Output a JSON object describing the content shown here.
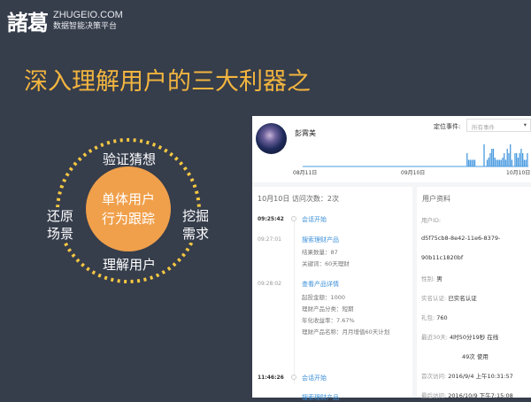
{
  "logo": {
    "cn": "諸葛",
    "en": "ZHUGEIO.COM",
    "sub": "数据智能决策平台"
  },
  "title": "深入理解用户的三大利器之",
  "diagram": {
    "center": [
      "单体用户",
      "行为跟踪"
    ],
    "top": "验证猜想",
    "left": [
      "还原",
      "场景"
    ],
    "right": [
      "挖掘",
      "需求"
    ],
    "bottom": "理解用户"
  },
  "colors": {
    "bg": "#363d4b",
    "accent": "#f3b53f",
    "orange": "#f0a04b",
    "dots": "#f5c842",
    "link": "#3b8fd9"
  },
  "panel": {
    "user_name": "彭霄美",
    "filter_label": "定位事件:",
    "filter_value": "所有事件",
    "chart_data": {
      "type": "bar",
      "x_labels": [
        "08月11日",
        "09月10日",
        "10月10日"
      ],
      "values": [
        0,
        0,
        0,
        0,
        0,
        0,
        0,
        0,
        0,
        0,
        0,
        0,
        0,
        0,
        0,
        0,
        0,
        0,
        0,
        0,
        0,
        0,
        0,
        0,
        0,
        0,
        0,
        0,
        0,
        0,
        0,
        0,
        0,
        0,
        0,
        0,
        0,
        0,
        0,
        0,
        0,
        0,
        0,
        0,
        0,
        0,
        0,
        0,
        0,
        0,
        0,
        0,
        0,
        0,
        0,
        0,
        0,
        0,
        0,
        0,
        0,
        0,
        0,
        0,
        0,
        0,
        0,
        0,
        0,
        0,
        0,
        0,
        0,
        0,
        0,
        0,
        0,
        0,
        0,
        0,
        0,
        0,
        0,
        0,
        0,
        0,
        0,
        0,
        0,
        0,
        0,
        0,
        0,
        0,
        0,
        0,
        0,
        0,
        0,
        0,
        0,
        0,
        0,
        0,
        0,
        0,
        3,
        1.5,
        1.5,
        1.5,
        1.5,
        1.5,
        0,
        0,
        0,
        0,
        0,
        5,
        0,
        1.5,
        2,
        3,
        4,
        4,
        2,
        1.5,
        1.5,
        1.5,
        1.5,
        2,
        3,
        1.5,
        4,
        3,
        5,
        1.5,
        0,
        3,
        3,
        2,
        3,
        4,
        3,
        1.5,
        1.5,
        3
      ]
    },
    "visit_header": "10月10日  访问次数：2次",
    "events": [
      {
        "time": "09:25:42",
        "name": "会话开始",
        "props": []
      },
      {
        "time": "09:27:01",
        "name": "搜索理财产品",
        "props": [
          "结果数量：87",
          "关键词：60天理财"
        ]
      },
      {
        "time": "09:28:02",
        "name": "查看产品详情",
        "props": [
          "起投金额：1000",
          "理财产品分类：短期",
          "年化收益率：7.67%",
          "理财产品名称：月月增值60天计划"
        ]
      },
      {
        "time": "11:46:26",
        "name": "会话开始",
        "props": []
      },
      {
        "time": "",
        "name": "搜索理财产品",
        "props": []
      }
    ],
    "profile": {
      "header": "用户资料",
      "id_label": "用户ID:",
      "id_1": "d5f75cb8-8e42-11e6-8379-",
      "id_2": "90b11c1820bf",
      "gender_label": "性别:",
      "gender": "男",
      "realname_label": "实名认证:",
      "realname": "已实名认证",
      "gift_label": "礼包:",
      "gift": "760",
      "recent_label": "最近30天:",
      "recent_1": "4时50分19秒 在线",
      "recent_2": "49次 使用",
      "first_label": "首次访问:",
      "first": "2016/9/4 上午10:31:57",
      "last_label": "最后访问:",
      "last": "2016/10/9 下午7:15:08"
    }
  }
}
